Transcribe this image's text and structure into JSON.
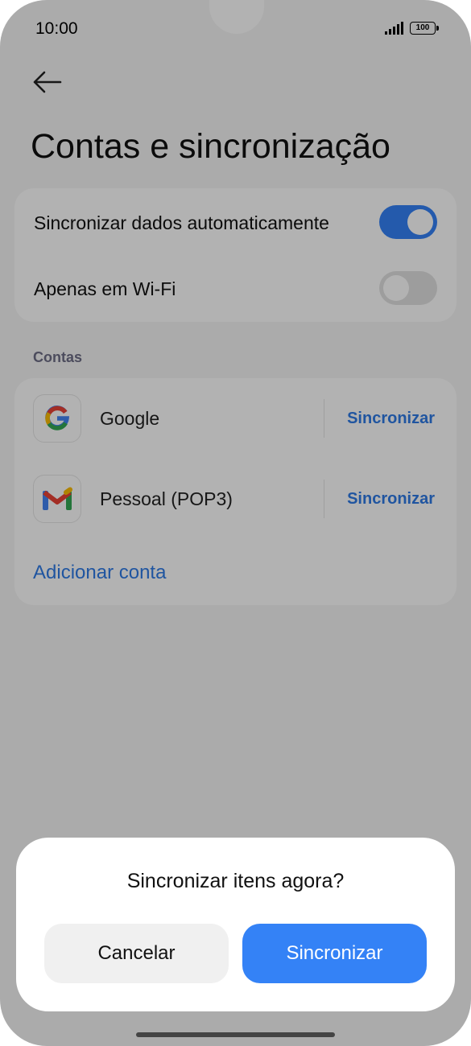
{
  "status_bar": {
    "time": "10:00",
    "battery": "100"
  },
  "header": {
    "title": "Contas e sincronização"
  },
  "sync_settings": {
    "auto_sync_label": "Sincronizar dados automaticamente",
    "auto_sync_on": true,
    "wifi_only_label": "Apenas em Wi-Fi",
    "wifi_only_on": false
  },
  "accounts": {
    "section_title": "Contas",
    "items": [
      {
        "name": "Google",
        "action": "Sincronizar",
        "icon": "google-icon"
      },
      {
        "name": "Pessoal (POP3)",
        "action": "Sincronizar",
        "icon": "gmail-icon"
      }
    ],
    "add_label": "Adicionar conta"
  },
  "dialog": {
    "title": "Sincronizar itens agora?",
    "cancel_label": "Cancelar",
    "confirm_label": "Sincronizar"
  },
  "colors": {
    "accent": "#3482f6",
    "link": "#2e7ae6",
    "toggle_off": "#e1e1e1",
    "overlay": "#000000"
  }
}
